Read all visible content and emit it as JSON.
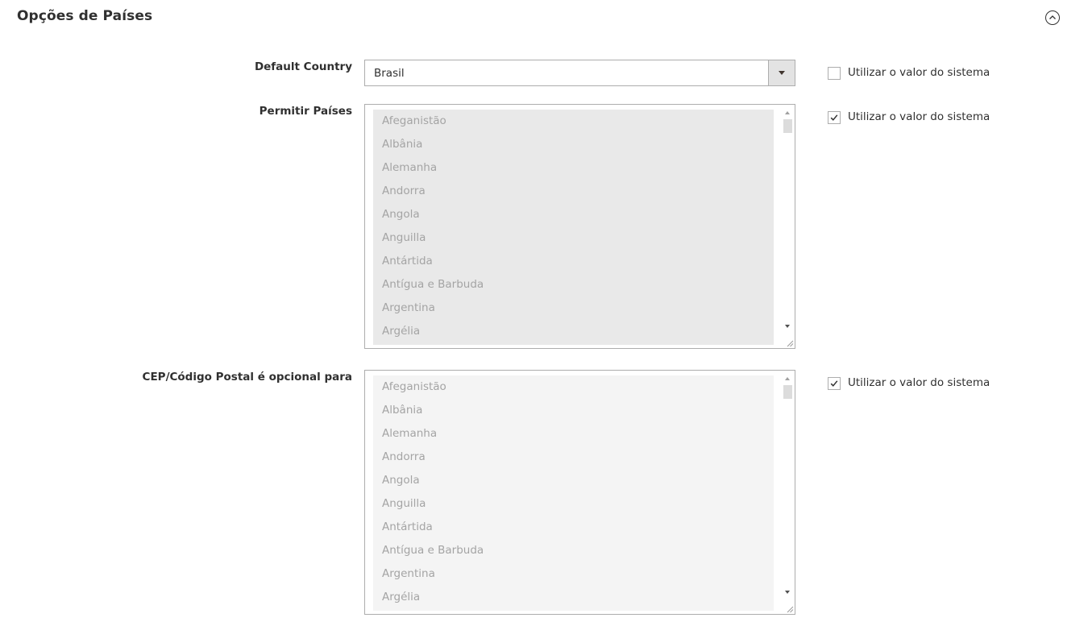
{
  "section": {
    "title": "Opções de Países"
  },
  "default_country": {
    "label": "Default Country",
    "value": "Brasil",
    "use_system_label": "Utilizar o valor do sistema",
    "use_system_checked": false
  },
  "allow_countries": {
    "label": "Permitir Países",
    "options": [
      "Afeganistão",
      "Albânia",
      "Alemanha",
      "Andorra",
      "Angola",
      "Anguilla",
      "Antártida",
      "Antígua e Barbuda",
      "Argentina",
      "Argélia"
    ],
    "use_system_label": "Utilizar o valor do sistema",
    "use_system_checked": true
  },
  "zip_optional": {
    "label": "CEP/Código Postal é opcional para",
    "options": [
      "Afeganistão",
      "Albânia",
      "Alemanha",
      "Andorra",
      "Angola",
      "Anguilla",
      "Antártida",
      "Antígua e Barbuda",
      "Argentina",
      "Argélia"
    ],
    "use_system_label": "Utilizar o valor do sistema",
    "use_system_checked": true
  }
}
